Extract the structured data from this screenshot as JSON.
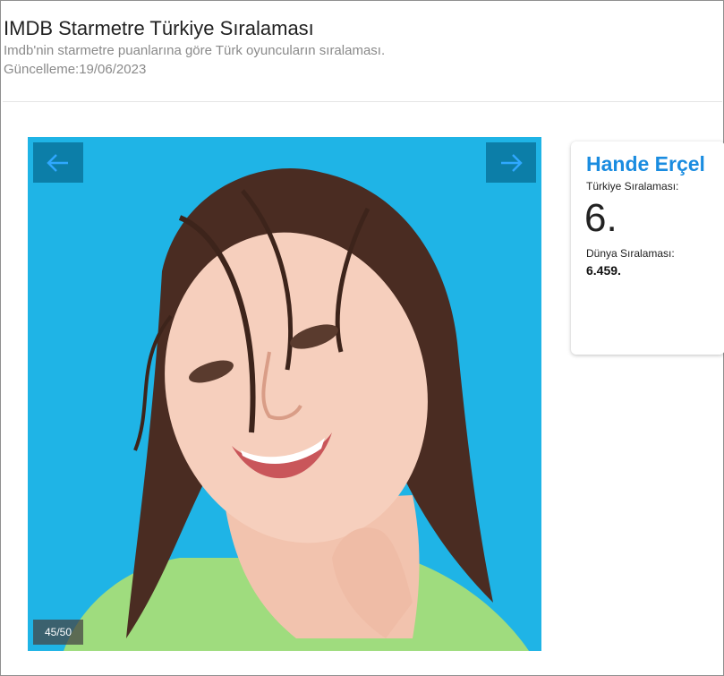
{
  "header": {
    "title": "IMDB Starmetre Türkiye Sıralaması",
    "subtitle": "Imdb'nin starmetre puanlarına göre Türk oyuncuların sıralaması.",
    "updated": "Güncelleme:19/06/2023"
  },
  "slider": {
    "counter": "45/50",
    "prev_icon": "arrow-left-icon",
    "next_icon": "arrow-right-icon",
    "photo_subject": "smiling-woman-photo"
  },
  "card": {
    "name": "Hande Erçel",
    "turkey_label": "Türkiye Sıralaması:",
    "turkey_rank": "6.",
    "world_label": "Dünya Sıralaması:",
    "world_rank": "6.459."
  },
  "colors": {
    "accent": "#1a8ce0",
    "photo_background": "#1fb4e6",
    "nav_button": "#0c7ea8"
  }
}
